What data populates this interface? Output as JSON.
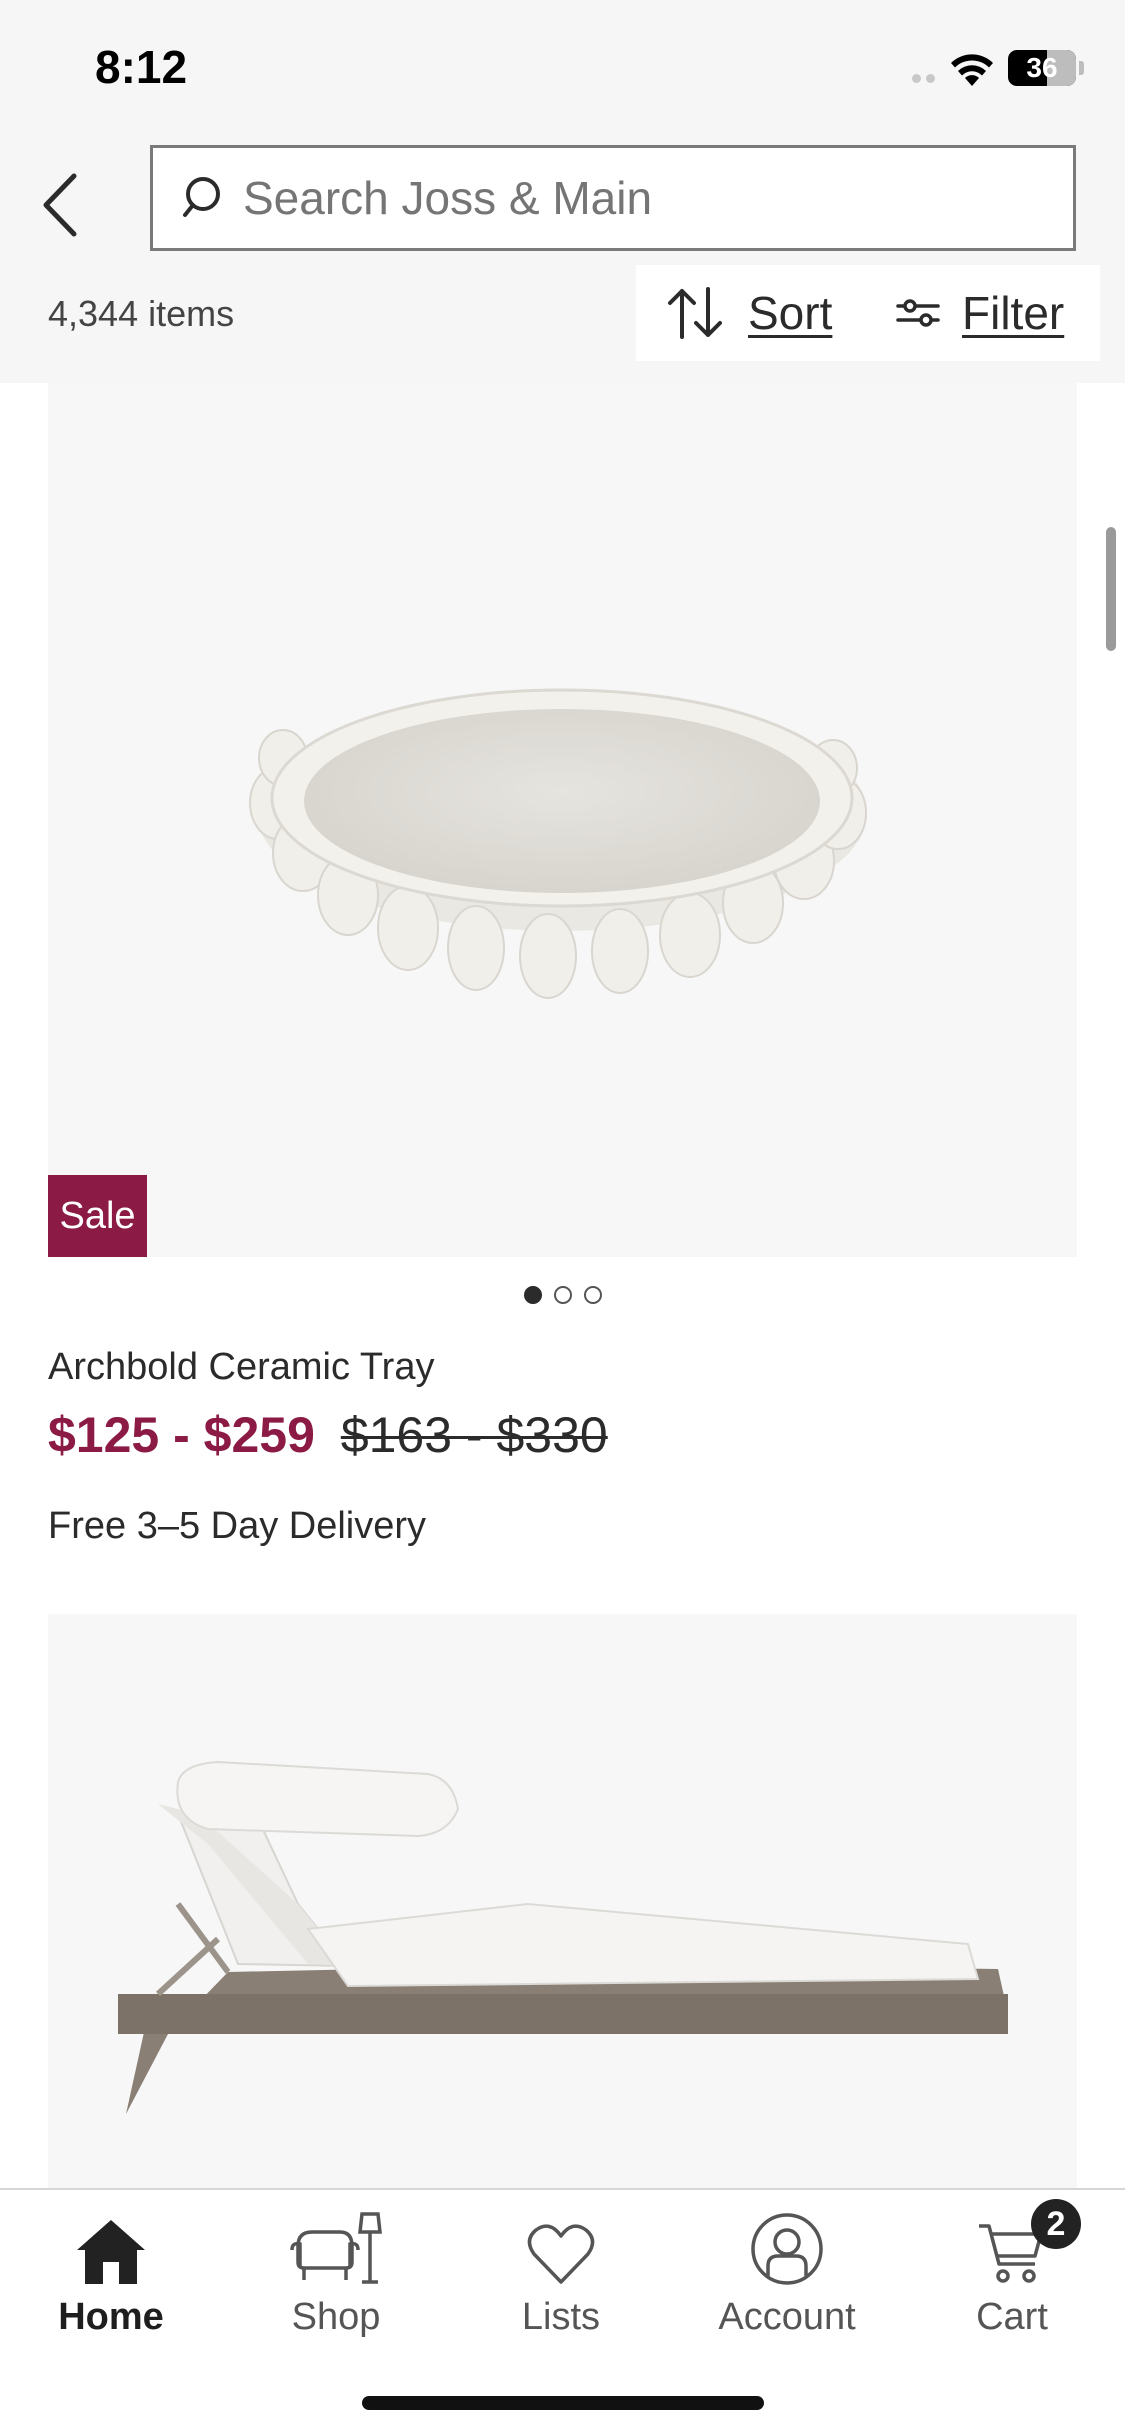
{
  "status_bar": {
    "time": "8:12",
    "battery": "36",
    "battery_level": 0.36
  },
  "search": {
    "placeholder": "Search Joss & Main"
  },
  "results": {
    "count_label": "4,344 items",
    "sort_label": "Sort",
    "filter_label": "Filter"
  },
  "products": [
    {
      "badge": "Sale",
      "name": "Archbold Ceramic Tray",
      "sale_price": "$125 - $259",
      "original_price": "$163 - $330",
      "delivery": "Free 3–5 Day Delivery",
      "image_count": 3,
      "active_image": 1
    }
  ],
  "colors": {
    "accent": "#8b1a44",
    "text": "#2b2b2b",
    "header_bg": "#f6f6f6"
  },
  "tab_bar": {
    "tabs": [
      {
        "label": "Home",
        "icon": "home-icon",
        "active": true
      },
      {
        "label": "Shop",
        "icon": "chair-lamp-icon",
        "active": false
      },
      {
        "label": "Lists",
        "icon": "heart-icon",
        "active": false
      },
      {
        "label": "Account",
        "icon": "account-icon",
        "active": false
      },
      {
        "label": "Cart",
        "icon": "cart-icon",
        "active": false
      }
    ],
    "cart_count": "2"
  }
}
